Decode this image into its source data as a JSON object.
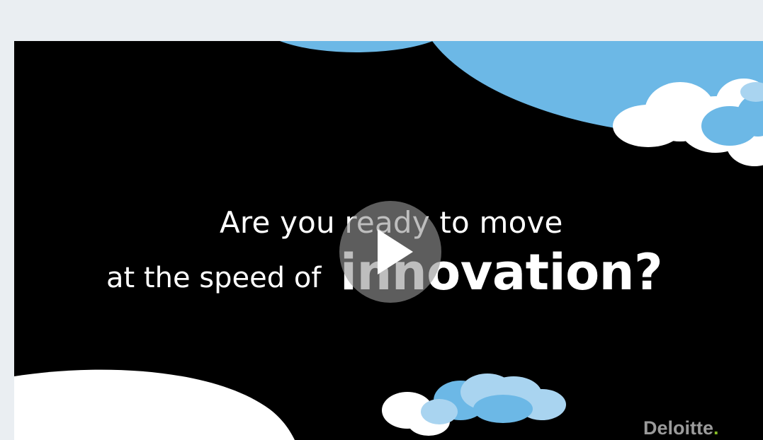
{
  "video": {
    "headline_line1": "Are you ready to move",
    "headline_line2_small": "at the speed of",
    "headline_line2_large": "innovation?",
    "play_icon": "play-icon",
    "logo_text": "Deloitte",
    "logo_dot": "."
  },
  "colors": {
    "page_background": "#eaeef2",
    "video_background": "#000000",
    "sky_blue": "#6cb8e6",
    "light_blue": "#a9d4f0",
    "cloud_white": "#ffffff",
    "logo_gray": "#9a9a9a",
    "logo_green": "#86bc25"
  }
}
